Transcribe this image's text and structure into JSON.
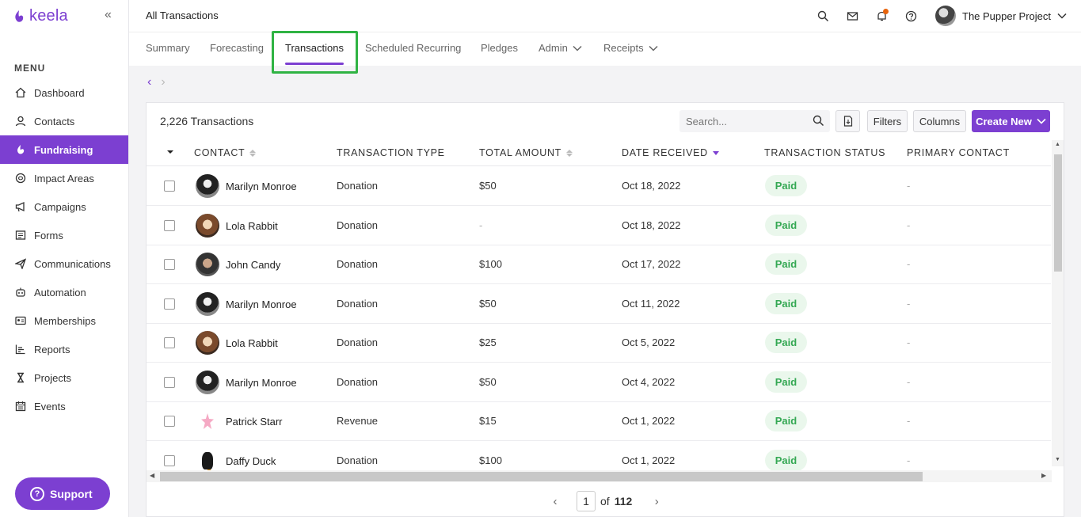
{
  "brand": {
    "name": "keela"
  },
  "sidebar": {
    "heading": "MENU",
    "items": [
      {
        "label": "Dashboard",
        "icon": "home-icon"
      },
      {
        "label": "Contacts",
        "icon": "user-icon"
      },
      {
        "label": "Fundraising",
        "icon": "fundraising-icon",
        "active": true
      },
      {
        "label": "Impact Areas",
        "icon": "impact-icon"
      },
      {
        "label": "Campaigns",
        "icon": "megaphone-icon"
      },
      {
        "label": "Forms",
        "icon": "form-icon"
      },
      {
        "label": "Communications",
        "icon": "send-icon"
      },
      {
        "label": "Automation",
        "icon": "robot-icon"
      },
      {
        "label": "Memberships",
        "icon": "id-card-icon"
      },
      {
        "label": "Reports",
        "icon": "chart-icon"
      },
      {
        "label": "Projects",
        "icon": "hourglass-icon"
      },
      {
        "label": "Events",
        "icon": "calendar-icon"
      }
    ],
    "support_label": "Support"
  },
  "header": {
    "title": "All Transactions",
    "account_name": "The Pupper Project"
  },
  "tabs": [
    {
      "label": "Summary"
    },
    {
      "label": "Forecasting"
    },
    {
      "label": "Transactions",
      "active": true
    },
    {
      "label": "Scheduled Recurring"
    },
    {
      "label": "Pledges"
    },
    {
      "label": "Admin",
      "dropdown": true
    },
    {
      "label": "Receipts",
      "dropdown": true
    }
  ],
  "card": {
    "title": "2,226 Transactions",
    "search_placeholder": "Search...",
    "filters_label": "Filters",
    "columns_label": "Columns",
    "create_label": "Create New"
  },
  "columns": {
    "contact": "CONTACT",
    "type": "TRANSACTION TYPE",
    "amount": "TOTAL AMOUNT",
    "date": "DATE RECEIVED",
    "status": "TRANSACTION STATUS",
    "primary": "PRIMARY CONTACT"
  },
  "rows": [
    {
      "contact": "Marilyn Monroe",
      "avatar": "mm",
      "type": "Donation",
      "amount": "$50",
      "date": "Oct 18, 2022",
      "status": "Paid",
      "primary": "-"
    },
    {
      "contact": "Lola Rabbit",
      "avatar": "lr",
      "type": "Donation",
      "amount": "-",
      "date": "Oct 18, 2022",
      "status": "Paid",
      "primary": "-"
    },
    {
      "contact": "John Candy",
      "avatar": "jc",
      "type": "Donation",
      "amount": "$100",
      "date": "Oct 17, 2022",
      "status": "Paid",
      "primary": "-"
    },
    {
      "contact": "Marilyn Monroe",
      "avatar": "mm",
      "type": "Donation",
      "amount": "$50",
      "date": "Oct 11, 2022",
      "status": "Paid",
      "primary": "-"
    },
    {
      "contact": "Lola Rabbit",
      "avatar": "lr",
      "type": "Donation",
      "amount": "$25",
      "date": "Oct 5, 2022",
      "status": "Paid",
      "primary": "-"
    },
    {
      "contact": "Marilyn Monroe",
      "avatar": "mm",
      "type": "Donation",
      "amount": "$50",
      "date": "Oct 4, 2022",
      "status": "Paid",
      "primary": "-"
    },
    {
      "contact": "Patrick Starr",
      "avatar": "ps",
      "type": "Revenue",
      "amount": "$15",
      "date": "Oct 1, 2022",
      "status": "Paid",
      "primary": "-"
    },
    {
      "contact": "Daffy Duck",
      "avatar": "dd",
      "type": "Donation",
      "amount": "$100",
      "date": "Oct 1, 2022",
      "status": "Paid",
      "primary": "-"
    }
  ],
  "pagination": {
    "current": "1",
    "of_label": "of",
    "total": "112"
  },
  "colors": {
    "accent": "#7c3fd1",
    "paid_text": "#34a853",
    "paid_bg": "#eaf7ec",
    "highlight": "#2fb343",
    "notification": "#e8640c"
  }
}
